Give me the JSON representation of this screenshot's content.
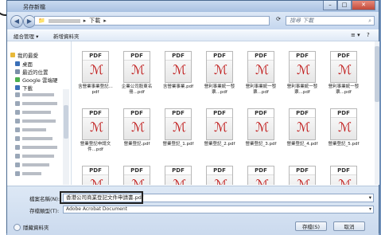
{
  "window": {
    "title": "另存新檔"
  },
  "address": {
    "segment": "下載"
  },
  "search": {
    "placeholder": "搜尋 下載"
  },
  "toolbar": {
    "organize": "組合管理 ▾",
    "new_folder": "新增資料夾"
  },
  "nav": {
    "favorites": "我的最愛",
    "items": [
      "桌面",
      "最近的位置",
      "Google 雲端硬",
      "下載"
    ]
  },
  "files": [
    {
      "name": "含營業事業登記...pdf"
    },
    {
      "name": "企業公司股東名冊...pdf"
    },
    {
      "name": "含營業事業.pdf"
    },
    {
      "name": "營利事業統一發票...pdf"
    },
    {
      "name": "營利事業統一發票...pdf"
    },
    {
      "name": "營利事業統一發票...pdf"
    },
    {
      "name": "營利事業統一發票...pdf"
    },
    {
      "name": "營業登記申請文件...pdf"
    },
    {
      "name": "營業登記.pdf"
    },
    {
      "name": "營業登記_1.pdf"
    },
    {
      "name": "營業登記_2.pdf"
    },
    {
      "name": "營業登記_3.pdf"
    },
    {
      "name": "營業登記_4.pdf"
    },
    {
      "name": "營業登記_5.pdf"
    }
  ],
  "bottom": {
    "filename_label": "檔案名稱(N):",
    "filename_value": "香港公司商業登記文件申請書.pdf",
    "filetype_label": "存檔類型(T):",
    "filetype_value": "Adobe Acrobat Document",
    "save": "存檔(S)",
    "cancel": "取消",
    "hide_folders": "隱藏資料夾"
  },
  "pdf_label": "PDF"
}
